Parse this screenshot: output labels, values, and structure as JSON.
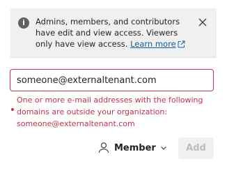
{
  "info_banner": {
    "icon": "info-icon",
    "message": "Admins, members, and contributors have edit and view access. Viewers only have view access.",
    "learn_more_label": "Learn more",
    "close_icon": "close-icon"
  },
  "email_input": {
    "value": "someone@externaltenant.com"
  },
  "error": {
    "message": "One or more e-mail addresses with the following domains are outside your organization: someone@externaltenant.com"
  },
  "role_select": {
    "icon": "person-icon",
    "selected": "Member"
  },
  "add_button": {
    "label": "Add",
    "disabled": true
  },
  "colors": {
    "error": "#c4314b",
    "link": "#115ea3",
    "banner_bg": "#f0f0f0",
    "disabled_text": "#bdbdbd"
  }
}
